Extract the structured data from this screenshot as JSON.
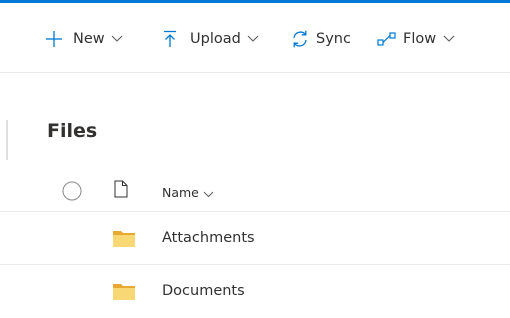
{
  "toolbar": {
    "new_label": "New",
    "upload_label": "Upload",
    "sync_label": "Sync",
    "flow_label": "Flow"
  },
  "page": {
    "title": "Files"
  },
  "list": {
    "columns": {
      "name_label": "Name"
    },
    "items": [
      {
        "name": "Attachments",
        "type": "folder"
      },
      {
        "name": "Documents",
        "type": "folder"
      }
    ]
  },
  "colors": {
    "accent": "#0078d4",
    "folder": "#f8d775",
    "text": "#323130"
  },
  "icons": {
    "new": "plus-icon",
    "upload": "upload-arrow-icon",
    "sync": "sync-icon",
    "flow": "flow-icon",
    "select_all": "circle-checkbox-icon",
    "file_type": "document-icon",
    "folder": "folder-icon"
  }
}
